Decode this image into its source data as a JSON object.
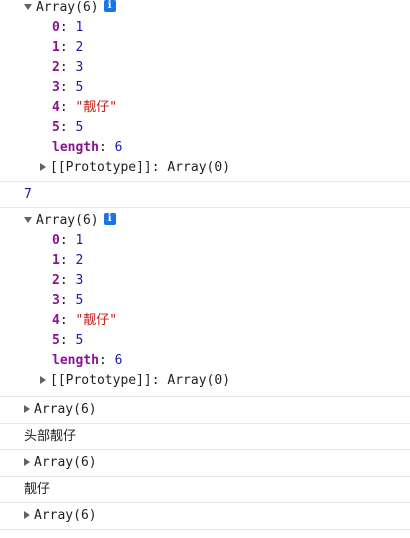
{
  "console": {
    "expanded_array_1": {
      "header": "Array(6)",
      "info_icon": "info-icon",
      "items": [
        {
          "key": "0",
          "value": "1",
          "type": "number"
        },
        {
          "key": "1",
          "value": "2",
          "type": "number"
        },
        {
          "key": "2",
          "value": "3",
          "type": "number"
        },
        {
          "key": "3",
          "value": "5",
          "type": "number"
        },
        {
          "key": "4",
          "value": "\"靓仔\"",
          "type": "string"
        },
        {
          "key": "5",
          "value": "5",
          "type": "number"
        }
      ],
      "length_key": "length",
      "length_value": "6",
      "prototype_label": "[[Prototype]]",
      "prototype_value": "Array(0)"
    },
    "number_log": "7",
    "expanded_array_2": {
      "header": "Array(6)",
      "info_icon": "info-icon",
      "items": [
        {
          "key": "0",
          "value": "1",
          "type": "number"
        },
        {
          "key": "1",
          "value": "2",
          "type": "number"
        },
        {
          "key": "2",
          "value": "3",
          "type": "number"
        },
        {
          "key": "3",
          "value": "5",
          "type": "number"
        },
        {
          "key": "4",
          "value": "\"靓仔\"",
          "type": "string"
        },
        {
          "key": "5",
          "value": "5",
          "type": "number"
        }
      ],
      "length_key": "length",
      "length_value": "6",
      "prototype_label": "[[Prototype]]",
      "prototype_value": "Array(0)"
    },
    "collapsed_array_1": "Array(6)",
    "text_log_1": "头部靓仔",
    "collapsed_array_2": "Array(6)",
    "text_log_2": "靓仔",
    "collapsed_array_3": "Array(6)"
  }
}
